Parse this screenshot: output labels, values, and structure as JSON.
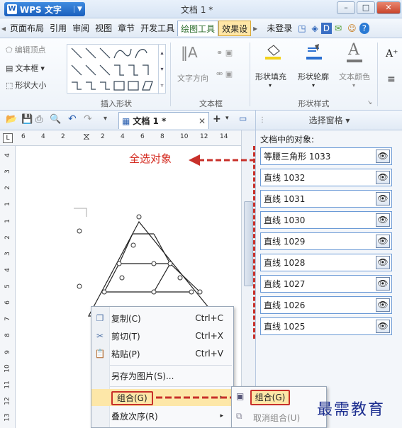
{
  "app": {
    "name": "WPS 文字",
    "logo": "W",
    "doc_title": "文档 1 *"
  },
  "window": {
    "minimize": "–",
    "maximize": "□",
    "close": "✕"
  },
  "menu": {
    "items": [
      "页面布局",
      "引用",
      "审阅",
      "视图",
      "章节",
      "开发工具",
      "绘图工具",
      "效果设"
    ],
    "login": "未登录"
  },
  "ribbon": {
    "edit_vertex": "编辑顶点",
    "textbox": "文本框",
    "shape_size": "形状大小",
    "insert_shape_label": "插入形状",
    "text_direction": "文字方向",
    "textbox_group_label": "文本框",
    "fill": "形状填充",
    "outline": "形状轮廓",
    "text_color": "文本颜色",
    "shape_style_label": "形状样式"
  },
  "doc_tab": {
    "title": "文档 1 *"
  },
  "ruler": {
    "h_ticks": [
      "6",
      "4",
      "2",
      "",
      "2",
      "4",
      "6",
      "8",
      "10",
      "12",
      "14"
    ],
    "v_ticks": [
      "4",
      "3",
      "2",
      "1",
      "1",
      "2",
      "3",
      "4",
      "5",
      "6",
      "7",
      "8",
      "9",
      "10",
      "11",
      "12",
      "13"
    ]
  },
  "pane": {
    "title": "选择窗格 ▾",
    "subtitle": "文档中的对象:",
    "objects": [
      "等腰三角形 1033",
      "直线 1032",
      "直线 1031",
      "直线 1030",
      "直线 1029",
      "直线 1028",
      "直线 1027",
      "直线 1026",
      "直线 1025"
    ]
  },
  "annotation": {
    "select_all": "全选对象"
  },
  "context_menu": {
    "copy": "复制(C)",
    "copy_sc": "Ctrl+C",
    "cut": "剪切(T)",
    "cut_sc": "Ctrl+X",
    "paste": "粘贴(P)",
    "paste_sc": "Ctrl+V",
    "save_as_image": "另存为图片(S)...",
    "group": "组合(G)",
    "order": "叠放次序(R)"
  },
  "submenu": {
    "group": "组合(G)",
    "ungroup": "取消组合(U)"
  },
  "watermark": "最需教育",
  "colors": {
    "accent_red": "#c8302a",
    "selection_blue": "#6b9ad6"
  }
}
